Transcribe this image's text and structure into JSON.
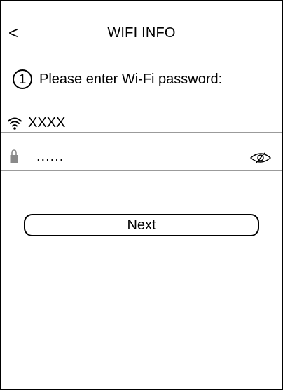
{
  "header": {
    "back_glyph": "<",
    "title": "WIFI INFO"
  },
  "step": {
    "number": "1",
    "instruction": "Please enter Wi-Fi password:"
  },
  "wifi": {
    "icon": "wifi-icon",
    "ssid": "XXXX"
  },
  "password": {
    "icon": "lock-icon",
    "value": "......",
    "visibility_icon": "eye-off-icon"
  },
  "actions": {
    "next_label": "Next"
  },
  "colors": {
    "divider": "#9b9b9b",
    "lock": "#8a8a8a"
  }
}
